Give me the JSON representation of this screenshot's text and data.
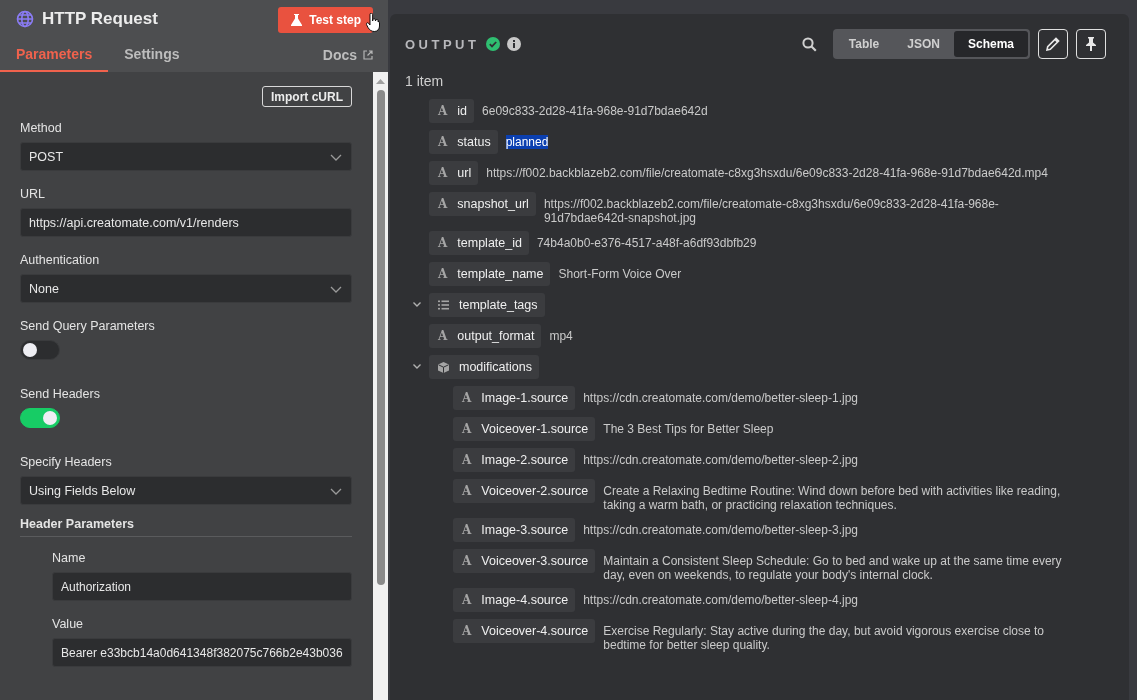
{
  "node": {
    "title": "HTTP Request",
    "test_button": "Test step"
  },
  "tabs": [
    {
      "label": "Parameters",
      "selected": true
    },
    {
      "label": "Settings",
      "selected": false
    }
  ],
  "docs_link": "Docs",
  "import_button": "Import cURL",
  "parameters": [
    {
      "kind": "select",
      "label": "Method",
      "value": "POST"
    },
    {
      "kind": "input",
      "label": "URL",
      "value": "https://api.creatomate.com/v1/renders"
    },
    {
      "kind": "select",
      "label": "Authentication",
      "value": "None"
    },
    {
      "kind": "toggle",
      "label": "Send Query Parameters",
      "on": false
    },
    {
      "kind": "toggle",
      "label": "Send Headers",
      "on": true
    },
    {
      "kind": "select",
      "label": "Specify Headers",
      "value": "Using Fields Below"
    },
    {
      "kind": "section",
      "label": "Header Parameters"
    },
    {
      "kind": "nested_input",
      "label": "Name",
      "value": "Authorization"
    },
    {
      "kind": "nested_input",
      "label": "Value",
      "value": "Bearer e33bcb14a0d641348f382075c766b2e43b036"
    }
  ],
  "output": {
    "title": "OUTPUT",
    "views": [
      {
        "label": "Table",
        "selected": false
      },
      {
        "label": "JSON",
        "selected": false
      },
      {
        "label": "Schema",
        "selected": true
      }
    ],
    "count": "1 item",
    "fields": [
      {
        "kind": "string",
        "type_label": "A",
        "key": "id",
        "value": "6e09c833-2d28-41fa-968e-91d7bdae642d",
        "highlighted": false
      },
      {
        "kind": "string",
        "type_label": "A",
        "key": "status",
        "value": "planned",
        "highlighted": true
      },
      {
        "kind": "string",
        "type_label": "A",
        "key": "url",
        "value": "https://f002.backblazeb2.com/file/creatomate-c8xg3hsxdu/6e09c833-2d28-41fa-968e-91d7bdae642d.mp4",
        "highlighted": false
      },
      {
        "kind": "string",
        "type_label": "A",
        "key": "snapshot_url",
        "value": "https://f002.backblazeb2.com/file/creatomate-c8xg3hsxdu/6e09c833-2d28-41fa-968e-91d7bdae642d-snapshot.jpg",
        "highlighted": false
      },
      {
        "kind": "string",
        "type_label": "A",
        "key": "template_id",
        "value": "74b4a0b0-e376-4517-a48f-a6df93dbfb29",
        "highlighted": false
      },
      {
        "kind": "string",
        "type_label": "A",
        "key": "template_name",
        "value": "Short-Form Voice Over",
        "highlighted": false
      },
      {
        "kind": "array",
        "key": "template_tags",
        "expanded": true
      },
      {
        "kind": "string",
        "type_label": "A",
        "key": "output_format",
        "value": "mp4",
        "highlighted": false
      },
      {
        "kind": "object",
        "key": "modifications",
        "expanded": true,
        "children": [
          {
            "kind": "string",
            "type_label": "A",
            "key": "Image-1.source",
            "value": "https://cdn.creatomate.com/demo/better-sleep-1.jpg",
            "highlighted": false
          },
          {
            "kind": "string",
            "type_label": "A",
            "key": "Voiceover-1.source",
            "value": "The 3 Best Tips for Better Sleep",
            "highlighted": false
          },
          {
            "kind": "string",
            "type_label": "A",
            "key": "Image-2.source",
            "value": "https://cdn.creatomate.com/demo/better-sleep-2.jpg",
            "highlighted": false
          },
          {
            "kind": "string",
            "type_label": "A",
            "key": "Voiceover-2.source",
            "value": "Create a Relaxing Bedtime Routine: Wind down before bed with activities like reading, taking a warm bath, or practicing relaxation techniques.",
            "highlighted": false
          },
          {
            "kind": "string",
            "type_label": "A",
            "key": "Image-3.source",
            "value": "https://cdn.creatomate.com/demo/better-sleep-3.jpg",
            "highlighted": false
          },
          {
            "kind": "string",
            "type_label": "A",
            "key": "Voiceover-3.source",
            "value": "Maintain a Consistent Sleep Schedule: Go to bed and wake up at the same time every day, even on weekends, to regulate your body's internal clock.",
            "highlighted": false
          },
          {
            "kind": "string",
            "type_label": "A",
            "key": "Image-4.source",
            "value": "https://cdn.creatomate.com/demo/better-sleep-4.jpg",
            "highlighted": false
          },
          {
            "kind": "string",
            "type_label": "A",
            "key": "Voiceover-4.source",
            "value": "Exercise Regularly: Stay active during the day, but avoid vigorous exercise close to bedtime for better sleep quality.",
            "highlighted": false
          }
        ]
      }
    ]
  }
}
